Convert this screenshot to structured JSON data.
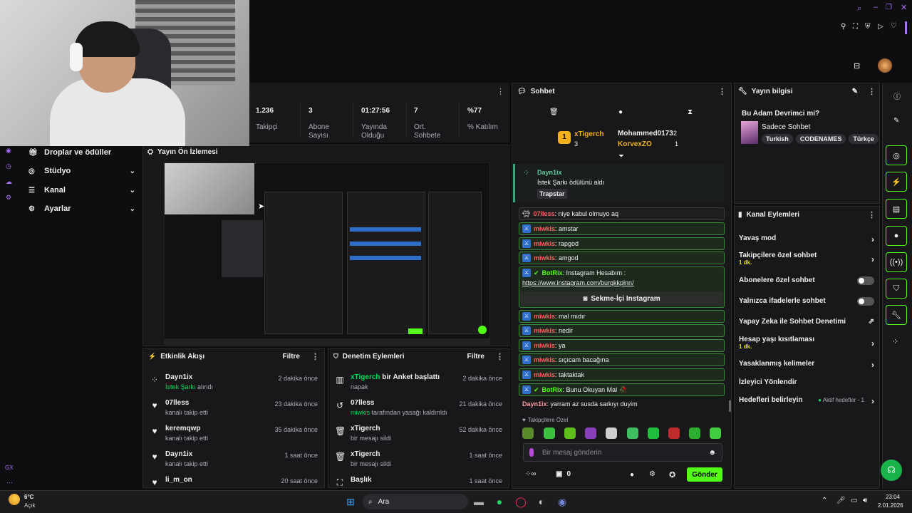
{
  "topbar": {
    "icons": [
      "search-icon",
      "minimize-icon",
      "maximize-icon",
      "close-icon",
      "pin-icon",
      "crop-icon",
      "shield-icon",
      "play-icon",
      "heart-icon"
    ]
  },
  "stats": [
    {
      "value": "1.236",
      "label": "Takipçi"
    },
    {
      "value": "3",
      "label": "Abone Sayısı"
    },
    {
      "value": "01:27:56",
      "label": "Yayında Olduğu"
    },
    {
      "value": "7",
      "label": "Ort. Sohbete"
    },
    {
      "value": "%77",
      "label": "% Katılım"
    }
  ],
  "nav": [
    {
      "label": "Droplar ve ödüller"
    },
    {
      "label": "Stüdyo"
    },
    {
      "label": "Kanal"
    },
    {
      "label": "Ayarlar"
    }
  ],
  "preview": {
    "title": "Yayın Ön İzlemesi"
  },
  "activity": {
    "title": "Etkinlik Akışı",
    "filter": "Filtre",
    "items": [
      {
        "name": "Dayn1ix",
        "sub_hl": "İstek Şarkı",
        "sub": " alındı",
        "time": "2 dakika önce"
      },
      {
        "name": "07lless",
        "sub_hl": "",
        "sub": "kanalı takip etti",
        "time": "23 dakika önce"
      },
      {
        "name": "keremqwp",
        "sub_hl": "",
        "sub": "kanalı takip etti",
        "time": "35 dakika önce"
      },
      {
        "name": "Dayn1ix",
        "sub_hl": "",
        "sub": "kanalı takip etti",
        "time": "1 saat önce"
      },
      {
        "name": "li_m_on",
        "sub_hl": "",
        "sub": "",
        "time": "20 saat önce"
      }
    ]
  },
  "moderation": {
    "title": "Denetim Eylemleri",
    "filter": "Filtre",
    "items": [
      {
        "hl": "xTigerch",
        "name": " bir Anket başlattı",
        "sub_hl": "",
        "sub": "napak",
        "time": "2 dakika önce"
      },
      {
        "hl": "",
        "name": "07lless",
        "sub_hl": "miwkis",
        "sub": " tarafından yasağı kaldırıldı",
        "time": "21 dakika önce"
      },
      {
        "hl": "",
        "name": "xTigerch",
        "sub_hl": "",
        "sub": "bir mesajı sildi",
        "time": "52 dakika önce"
      },
      {
        "hl": "",
        "name": "xTigerch",
        "sub_hl": "",
        "sub": "bir mesajı sildi",
        "time": "1 saat önce"
      },
      {
        "hl": "",
        "name": "Başlık",
        "sub_hl": "",
        "sub": "",
        "time": "1 saat önce"
      }
    ]
  },
  "chat": {
    "title": "Sohbet",
    "leaders": {
      "first_name": "xTigerch",
      "first_count": "3",
      "second_name": "Mohammed0173",
      "second_count": "2",
      "third_name": "KorvexZO",
      "third_count": "1"
    },
    "reward": {
      "user": "Dayn1ix",
      "text": "İstek Şarkı ödülünü aldı",
      "tag": "Trapstar"
    },
    "messages": [
      {
        "user": "07lless",
        "text": ": niye kabul olmuyo aq"
      },
      {
        "user": "miwkis",
        "text": ": amstar"
      },
      {
        "user": "miwkis",
        "text": ": rapgod"
      },
      {
        "user": "miwkis",
        "text": ": amgod"
      }
    ],
    "bot1": {
      "user": "BotRix",
      "text": ": Instagram Hesabım :",
      "link": "https://www.instagram.com/burqkkplnn/",
      "button": "Sekme-İçi Instagram"
    },
    "messages2": [
      {
        "user": "miwkis",
        "text": ": mal mıdır"
      },
      {
        "user": "miwkis",
        "text": ": nedir"
      },
      {
        "user": "miwkis",
        "text": ": ya"
      },
      {
        "user": "miwkis",
        "text": ": sıçıcam bacağına"
      },
      {
        "user": "miwkis",
        "text": ": taktaktak"
      }
    ],
    "bot2": {
      "user": "BotRix",
      "text": ": Bunu Okuyan Mal 🥀"
    },
    "last": {
      "user": "Dayn1ix",
      "text": ": yarram az susda sarkıyı duyim"
    },
    "follower_only": "Takipçilere Özel",
    "placeholder": "Bir mesaj gönderin",
    "points": "0",
    "send": "Gönder"
  },
  "info": {
    "title": "Yayın bilgisi",
    "stream_title": "Bu Adam Devrimci mi?",
    "category": "Sadece Sohbet",
    "tags": [
      "Turkish",
      "CODENAMES",
      "Türkçe"
    ]
  },
  "channel_actions": {
    "title": "Kanal Eylemleri",
    "slow": "Yavaş mod",
    "followers": "Takipçilere özel sohbet",
    "followers_sub": "1 dk.",
    "subs": "Abonelere özel sohbet",
    "emotes": "Yalnızca ifadelerle sohbet",
    "ai": "Yapay Zeka ile Sohbet Denetimi",
    "age": "Hesap yaşı kısıtlaması",
    "age_sub": "1 dk.",
    "banned": "Yasaklanmış kelimeler",
    "raid": "İzleyici Yönlendir",
    "goals": "Hedefleri belirleyin",
    "goals_status": "Aktif hedefler - 1"
  },
  "taskbar": {
    "weather_temp": "6°C",
    "weather_desc": "Açık",
    "search": "Ara",
    "time": "23:04",
    "date": "2.01.2026"
  },
  "colors": {
    "accent": "#53fc18",
    "twitch_purple": "#a970ff",
    "green": "#00e05a"
  }
}
